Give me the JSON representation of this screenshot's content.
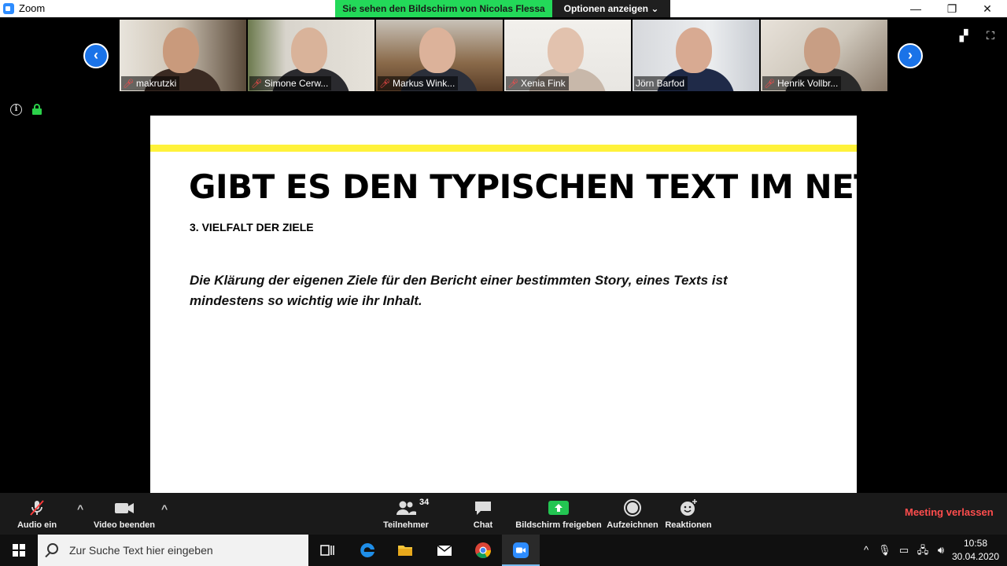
{
  "window": {
    "app_title": "Zoom",
    "share_banner": "Sie sehen den Bildschirm von Nicolas Flessa",
    "options_label": "Optionen anzeigen",
    "minimize": "—",
    "restore": "❐",
    "close": "✕"
  },
  "participants": [
    {
      "name": "makrutzki"
    },
    {
      "name": "Simone Cerw..."
    },
    {
      "name": "Markus Wink..."
    },
    {
      "name": "Xenia Fink"
    },
    {
      "name": "Jörn Barfod"
    },
    {
      "name": "Henrik Vollbr..."
    }
  ],
  "strip": {
    "prev_arrow": "‹",
    "next_arrow": "›"
  },
  "slide": {
    "heading": "GIBT ES DEN TYPISCHEN TEXT IM NETZ?",
    "subheading": "3. VIELFALT DER ZIELE",
    "body": "Die Klärung der eigenen Ziele für den Bericht einer bestimmten Story, eines Texts ist mindestens so wichtig wie ihr Inhalt.",
    "accent_color": "#fff23a"
  },
  "toolbar": {
    "audio_label": "Audio ein",
    "video_label": "Video beenden",
    "participants_label": "Teilnehmer",
    "participants_count": "34",
    "chat_label": "Chat",
    "share_label": "Bildschirm freigeben",
    "record_label": "Aufzeichnen",
    "reactions_label": "Reaktionen",
    "leave_label": "Meeting verlassen",
    "leave_color": "#ff4d4d",
    "share_color": "#23c552"
  },
  "taskbar": {
    "search_placeholder": "Zur Suche Text hier eingeben",
    "time": "10:58",
    "date": "30.04.2020"
  }
}
